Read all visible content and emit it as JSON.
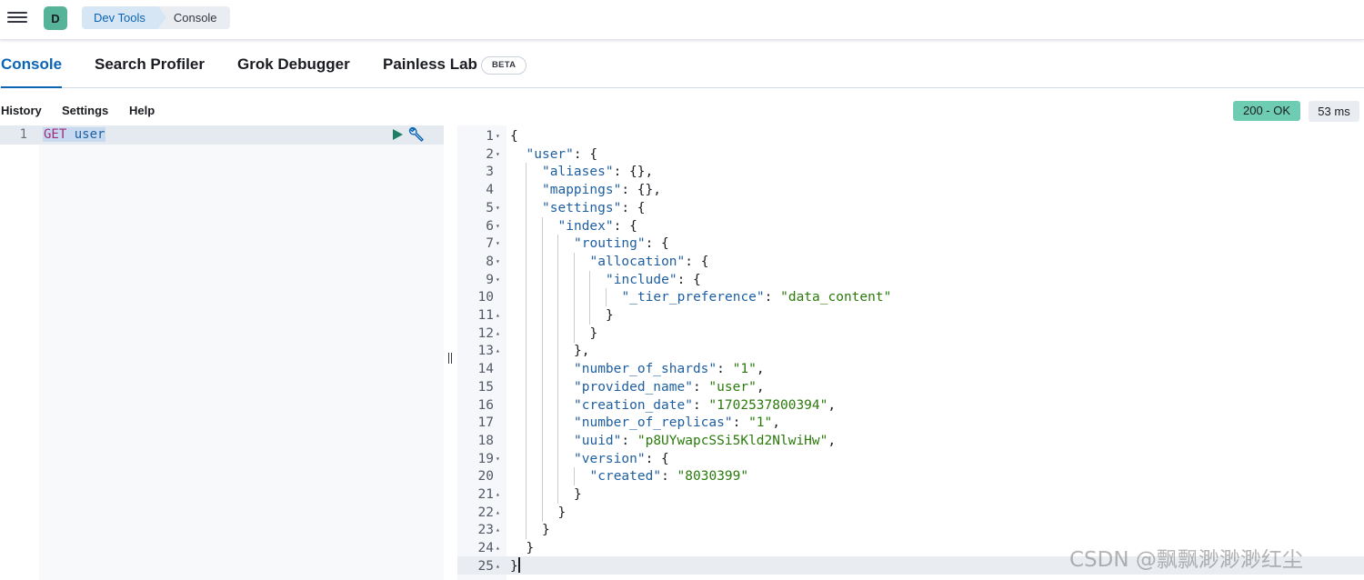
{
  "header": {
    "avatar_letter": "D",
    "breadcrumbs": [
      "Dev Tools",
      "Console"
    ]
  },
  "tabs": [
    {
      "label": "Console",
      "active": true
    },
    {
      "label": "Search Profiler",
      "active": false
    },
    {
      "label": "Grok Debugger",
      "active": false
    },
    {
      "label": "Painless Lab",
      "active": false,
      "badge": "BETA"
    }
  ],
  "toolbar": {
    "history": "History",
    "settings": "Settings",
    "help": "Help",
    "status": "200 - OK",
    "time": "53 ms"
  },
  "request": {
    "line_number": "1",
    "method": "GET",
    "path": "user"
  },
  "response": {
    "lines": [
      {
        "n": "1",
        "fold": "open",
        "depth": 0,
        "parts": [
          [
            "p",
            "{"
          ]
        ]
      },
      {
        "n": "2",
        "fold": "open",
        "depth": 1,
        "parts": [
          [
            "k",
            "\"user\""
          ],
          [
            "p",
            ": {"
          ]
        ]
      },
      {
        "n": "3",
        "fold": "",
        "depth": 2,
        "parts": [
          [
            "k",
            "\"aliases\""
          ],
          [
            "p",
            ": {},"
          ]
        ]
      },
      {
        "n": "4",
        "fold": "",
        "depth": 2,
        "parts": [
          [
            "k",
            "\"mappings\""
          ],
          [
            "p",
            ": {},"
          ]
        ]
      },
      {
        "n": "5",
        "fold": "open",
        "depth": 2,
        "parts": [
          [
            "k",
            "\"settings\""
          ],
          [
            "p",
            ": {"
          ]
        ]
      },
      {
        "n": "6",
        "fold": "open",
        "depth": 3,
        "parts": [
          [
            "k",
            "\"index\""
          ],
          [
            "p",
            ": {"
          ]
        ]
      },
      {
        "n": "7",
        "fold": "open",
        "depth": 4,
        "parts": [
          [
            "k",
            "\"routing\""
          ],
          [
            "p",
            ": {"
          ]
        ]
      },
      {
        "n": "8",
        "fold": "open",
        "depth": 5,
        "parts": [
          [
            "k",
            "\"allocation\""
          ],
          [
            "p",
            ": {"
          ]
        ]
      },
      {
        "n": "9",
        "fold": "open",
        "depth": 6,
        "parts": [
          [
            "k",
            "\"include\""
          ],
          [
            "p",
            ": {"
          ]
        ]
      },
      {
        "n": "10",
        "fold": "",
        "depth": 7,
        "parts": [
          [
            "k",
            "\"_tier_preference\""
          ],
          [
            "p",
            ": "
          ],
          [
            "s",
            "\"data_content\""
          ]
        ]
      },
      {
        "n": "11",
        "fold": "close",
        "depth": 6,
        "parts": [
          [
            "p",
            "}"
          ]
        ]
      },
      {
        "n": "12",
        "fold": "close",
        "depth": 5,
        "parts": [
          [
            "p",
            "}"
          ]
        ]
      },
      {
        "n": "13",
        "fold": "close",
        "depth": 4,
        "parts": [
          [
            "p",
            "},"
          ]
        ]
      },
      {
        "n": "14",
        "fold": "",
        "depth": 4,
        "parts": [
          [
            "k",
            "\"number_of_shards\""
          ],
          [
            "p",
            ": "
          ],
          [
            "s",
            "\"1\""
          ],
          [
            "p",
            ","
          ]
        ]
      },
      {
        "n": "15",
        "fold": "",
        "depth": 4,
        "parts": [
          [
            "k",
            "\"provided_name\""
          ],
          [
            "p",
            ": "
          ],
          [
            "s",
            "\"user\""
          ],
          [
            "p",
            ","
          ]
        ]
      },
      {
        "n": "16",
        "fold": "",
        "depth": 4,
        "parts": [
          [
            "k",
            "\"creation_date\""
          ],
          [
            "p",
            ": "
          ],
          [
            "s",
            "\"1702537800394\""
          ],
          [
            "p",
            ","
          ]
        ]
      },
      {
        "n": "17",
        "fold": "",
        "depth": 4,
        "parts": [
          [
            "k",
            "\"number_of_replicas\""
          ],
          [
            "p",
            ": "
          ],
          [
            "s",
            "\"1\""
          ],
          [
            "p",
            ","
          ]
        ]
      },
      {
        "n": "18",
        "fold": "",
        "depth": 4,
        "parts": [
          [
            "k",
            "\"uuid\""
          ],
          [
            "p",
            ": "
          ],
          [
            "s",
            "\"p8UYwapcSSi5Kld2NlwiHw\""
          ],
          [
            "p",
            ","
          ]
        ]
      },
      {
        "n": "19",
        "fold": "open",
        "depth": 4,
        "parts": [
          [
            "k",
            "\"version\""
          ],
          [
            "p",
            ": {"
          ]
        ]
      },
      {
        "n": "20",
        "fold": "",
        "depth": 5,
        "parts": [
          [
            "k",
            "\"created\""
          ],
          [
            "p",
            ": "
          ],
          [
            "s",
            "\"8030399\""
          ]
        ]
      },
      {
        "n": "21",
        "fold": "close",
        "depth": 4,
        "parts": [
          [
            "p",
            "}"
          ]
        ]
      },
      {
        "n": "22",
        "fold": "close",
        "depth": 3,
        "parts": [
          [
            "p",
            "}"
          ]
        ]
      },
      {
        "n": "23",
        "fold": "close",
        "depth": 2,
        "parts": [
          [
            "p",
            "}"
          ]
        ]
      },
      {
        "n": "24",
        "fold": "close",
        "depth": 1,
        "parts": [
          [
            "p",
            "}"
          ]
        ]
      },
      {
        "n": "25",
        "fold": "close",
        "depth": 0,
        "parts": [
          [
            "p",
            "}"
          ]
        ],
        "cursor": true
      }
    ]
  },
  "watermark": "CSDN @飘飘渺渺渺红尘",
  "colors": {
    "accent": "#0b64b4",
    "status_ok": "#6dccb1",
    "json_key": "#1f5fa0",
    "json_string": "#2b7a0b"
  }
}
